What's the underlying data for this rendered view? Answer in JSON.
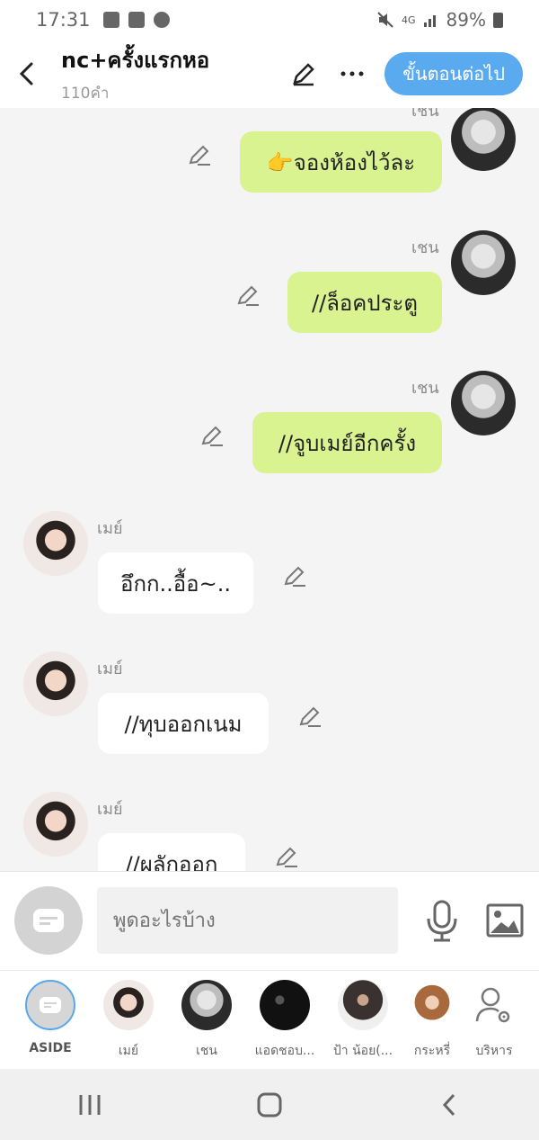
{
  "status_bar": {
    "time": "17:31",
    "battery": "89%",
    "network": "4G"
  },
  "header": {
    "title": "nc+ครั้งแรกหอ",
    "subtitle": "110คำ",
    "next_label": "ขั้นตอนต่อไป"
  },
  "messages": [
    {
      "sender": "เชน",
      "text": "👉จองห้องไว้ละ"
    },
    {
      "sender": "เชน",
      "text": "//ล็อคประตู"
    },
    {
      "sender": "เชน",
      "text": "//จูบเมย์อีกครั้ง"
    },
    {
      "sender": "เมย์",
      "text": "อึกก..อื้อ~.."
    },
    {
      "sender": "เมย์",
      "text": "//ทุบออกเนม"
    },
    {
      "sender": "เมย์",
      "text": "//ผลักออก"
    }
  ],
  "composer": {
    "placeholder": "พูดอะไรบ้าง"
  },
  "characters": [
    {
      "label": "ASIDE"
    },
    {
      "label": "เมย์"
    },
    {
      "label": "เชน"
    },
    {
      "label": "แอดชอบ..."
    },
    {
      "label": "ป้า น้อย(..."
    },
    {
      "label": "กระหรี่"
    },
    {
      "label": "บริหาร"
    }
  ],
  "colors": {
    "accent": "#5aaaf0",
    "my_bubble": "#d8f390",
    "their_bubble": "#ffffff",
    "background": "#f4f4f4"
  }
}
